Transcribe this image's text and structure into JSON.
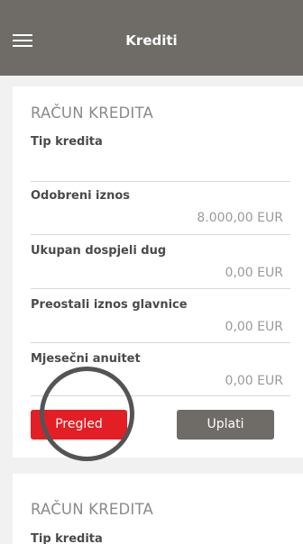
{
  "app_bar": {
    "title": "Krediti"
  },
  "cards": [
    {
      "section_title": "RAČUN KREDITA",
      "tip_label": "Tip kredita",
      "tip_value": "",
      "fields": [
        {
          "label": "Odobreni iznos",
          "value": "8.000,00 EUR"
        },
        {
          "label": "Ukupan dospjeli dug",
          "value": "0,00 EUR"
        },
        {
          "label": "Preostali iznos glavnice",
          "value": "0,00 EUR"
        },
        {
          "label": "Mjesečni anuitet",
          "value": "0,00 EUR"
        }
      ],
      "buttons": {
        "primary": "Pregled",
        "secondary": "Uplati"
      }
    },
    {
      "section_title": "RAČUN KREDITA",
      "tip_label": "Tip kredita"
    }
  ],
  "colors": {
    "app_bar": "#6f6b67",
    "primary_button": "#e31e24",
    "secondary_button": "#6f6b67",
    "background": "#f1f1f1"
  },
  "icons": {
    "menu": "hamburger-menu-icon"
  }
}
